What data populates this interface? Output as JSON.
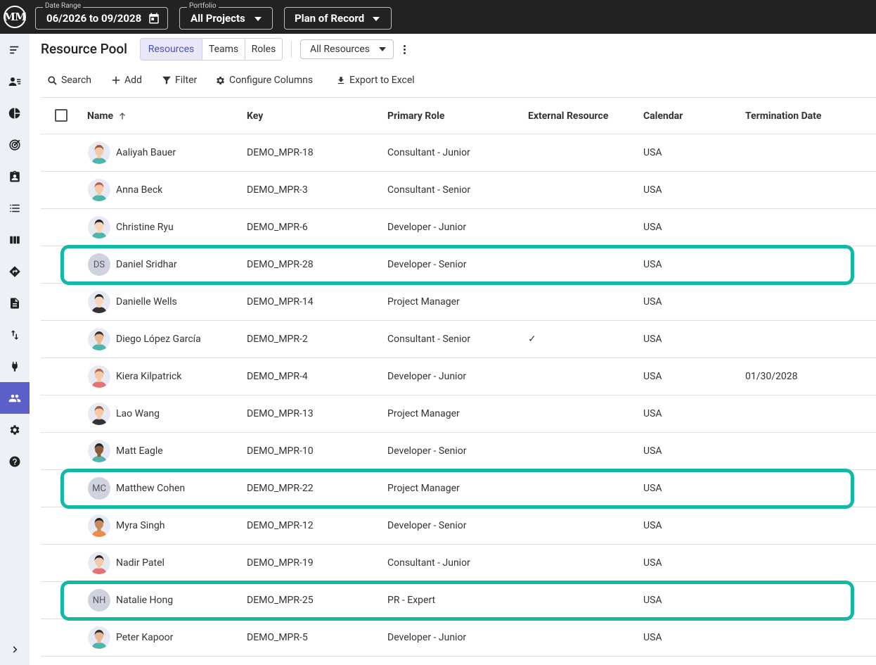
{
  "topbar": {
    "logo_text": "MM",
    "date_range": {
      "legend": "Date Range",
      "value": "06/2026 to 09/2028"
    },
    "portfolio": {
      "legend": "Portfolio",
      "value": "All Projects"
    },
    "plan": {
      "value": "Plan of Record"
    }
  },
  "sidebar": {
    "items": [
      {
        "icon": "menu-icon"
      },
      {
        "icon": "person-list-icon"
      },
      {
        "icon": "pie-chart-icon"
      },
      {
        "icon": "target-icon"
      },
      {
        "icon": "assignment-icon"
      },
      {
        "icon": "list-icon"
      },
      {
        "icon": "columns-icon"
      },
      {
        "icon": "directions-icon"
      },
      {
        "icon": "document-icon"
      },
      {
        "icon": "swap-vertical-icon"
      },
      {
        "icon": "plug-icon"
      },
      {
        "icon": "people-icon",
        "active": true
      },
      {
        "icon": "gear-icon"
      },
      {
        "icon": "help-icon"
      }
    ],
    "expand_icon": "chevron-right-icon"
  },
  "header": {
    "title": "Resource Pool",
    "tabs": [
      "Resources",
      "Teams",
      "Roles"
    ],
    "filter_value": "All Resources"
  },
  "toolbar": {
    "search": "Search",
    "add": "Add",
    "filter": "Filter",
    "configure_columns": "Configure Columns",
    "export": "Export to Excel"
  },
  "table": {
    "columns": [
      "Name",
      "Key",
      "Primary Role",
      "External Resource",
      "Calendar",
      "Termination Date"
    ],
    "rows": [
      {
        "name": "Aaliyah Bauer",
        "key": "DEMO_MPR-18",
        "role": "Consultant - Junior",
        "external": "",
        "calendar": "USA",
        "termination": "",
        "avatar": "illustration",
        "skin": "#f3c9a8",
        "hair": "#9c5a3c",
        "shirt": "#4db6ac"
      },
      {
        "name": "Anna Beck",
        "key": "DEMO_MPR-3",
        "role": "Consultant - Senior",
        "external": "",
        "calendar": "USA",
        "termination": "",
        "avatar": "illustration",
        "skin": "#f3c9a8",
        "hair": "#b8604a",
        "shirt": "#4db6ac"
      },
      {
        "name": "Christine Ryu",
        "key": "DEMO_MPR-6",
        "role": "Developer - Junior",
        "external": "",
        "calendar": "USA",
        "termination": "",
        "avatar": "illustration",
        "skin": "#f6d5bb",
        "hair": "#222222",
        "shirt": "#4db6ac"
      },
      {
        "name": "Daniel Sridhar",
        "key": "DEMO_MPR-28",
        "role": "Developer - Senior",
        "external": "",
        "calendar": "USA",
        "termination": "",
        "avatar": "initials",
        "initials": "DS",
        "highlighted": true
      },
      {
        "name": "Danielle Wells",
        "key": "DEMO_MPR-14",
        "role": "Project Manager",
        "external": "",
        "calendar": "USA",
        "termination": "",
        "avatar": "illustration",
        "skin": "#f6d5bb",
        "hair": "#222222",
        "shirt": "#333333"
      },
      {
        "name": "Diego López García",
        "key": "DEMO_MPR-2",
        "role": "Consultant - Senior",
        "external": "✓",
        "calendar": "USA",
        "termination": "",
        "avatar": "illustration",
        "skin": "#e9b894",
        "hair": "#3a2a22",
        "shirt": "#4db6ac"
      },
      {
        "name": "Kiera Kilpatrick",
        "key": "DEMO_MPR-4",
        "role": "Developer - Junior",
        "external": "",
        "calendar": "USA",
        "termination": "01/30/2028",
        "avatar": "illustration",
        "skin": "#f3c9a8",
        "hair": "#b8604a",
        "shirt": "#e57373"
      },
      {
        "name": "Lao Wang",
        "key": "DEMO_MPR-13",
        "role": "Project Manager",
        "external": "",
        "calendar": "USA",
        "termination": "",
        "avatar": "illustration",
        "skin": "#f3c9a8",
        "hair": "#9c5a3c",
        "shirt": "#333333"
      },
      {
        "name": "Matt Eagle",
        "key": "DEMO_MPR-10",
        "role": "Developer - Senior",
        "external": "",
        "calendar": "USA",
        "termination": "",
        "avatar": "illustration",
        "skin": "#8d5a3c",
        "hair": "#222222",
        "shirt": "#4db6ac"
      },
      {
        "name": "Matthew Cohen",
        "key": "DEMO_MPR-22",
        "role": "Project Manager",
        "external": "",
        "calendar": "USA",
        "termination": "",
        "avatar": "initials",
        "initials": "MC",
        "highlighted": true
      },
      {
        "name": "Myra Singh",
        "key": "DEMO_MPR-12",
        "role": "Developer - Senior",
        "external": "",
        "calendar": "USA",
        "termination": "",
        "avatar": "illustration",
        "skin": "#c68a5e",
        "hair": "#222222",
        "shirt": "#ef8a4a"
      },
      {
        "name": "Nadir Patel",
        "key": "DEMO_MPR-19",
        "role": "Consultant - Junior",
        "external": "",
        "calendar": "USA",
        "termination": "",
        "avatar": "illustration",
        "skin": "#f3c9a8",
        "hair": "#222222",
        "shirt": "#e57373"
      },
      {
        "name": "Natalie Hong",
        "key": "DEMO_MPR-25",
        "role": "PR - Expert",
        "external": "",
        "calendar": "USA",
        "termination": "",
        "avatar": "initials",
        "initials": "NH",
        "highlighted": true
      },
      {
        "name": "Peter Kapoor",
        "key": "DEMO_MPR-5",
        "role": "Developer - Junior",
        "external": "",
        "calendar": "USA",
        "termination": "",
        "avatar": "illustration",
        "skin": "#e9b894",
        "hair": "#3a2a22",
        "shirt": "#4db6ac"
      }
    ]
  },
  "colors": {
    "highlight": "#14b8a6",
    "accent": "#5b5fc7",
    "topbar": "#222222"
  }
}
